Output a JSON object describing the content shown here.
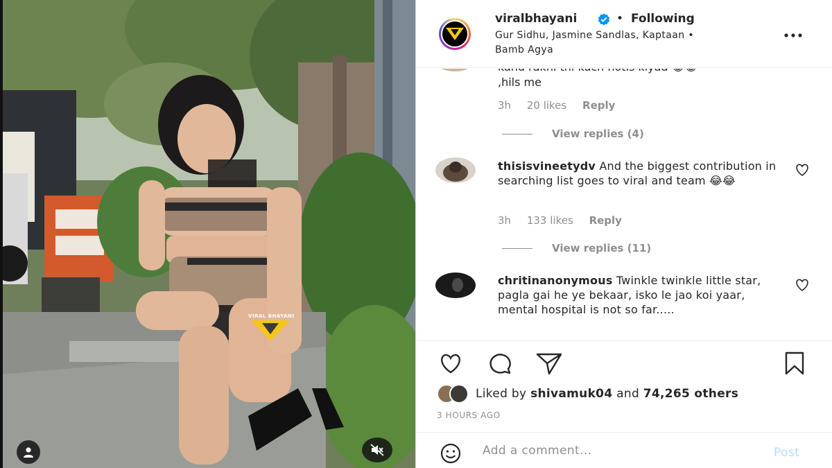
{
  "post": {
    "username": "viralbhayani",
    "separator": "•",
    "follow_status": "Following",
    "audio": "Gur Sidhu, Jasmine Sandlas, Kaptaan • Bamb Agya",
    "more_icon": "more-horizontal-icon",
    "watermark": "VIRAL BHAYANI"
  },
  "comments": {
    "partial": {
      "text_cut": "kahd rakhi thi kuch notis kiyad 😂😂",
      "text_line": ",hils me",
      "time": "3h",
      "likes": "20 likes",
      "reply": "Reply",
      "view_replies": "View replies (4)"
    },
    "items": [
      {
        "username": "thisisvineetydv",
        "text": "And the biggest contribution in searching list goes to viral and team 😂😂",
        "time": "3h",
        "likes": "133 likes",
        "reply": "Reply",
        "view_replies": "View replies (11)"
      },
      {
        "username": "chritinanonymous",
        "text": "Twinkle twinkle little star, pagla gai he ye bekaar, isko le jao koi yaar, mental hospital is not so far....."
      }
    ]
  },
  "actions": {
    "liked_prefix": "Liked by",
    "liked_user": "shivamuk04",
    "liked_and": "and",
    "liked_count": "74,265 others",
    "time_ago": "3 HOURS AGO"
  },
  "comment_box": {
    "placeholder": "Add a comment...",
    "post_label": "Post"
  },
  "colors": {
    "link_muted": "#8e8e8e",
    "post_disabled": "#b3dbff",
    "verified": "#0095f6",
    "watermark_yellow": "#f5c518"
  }
}
